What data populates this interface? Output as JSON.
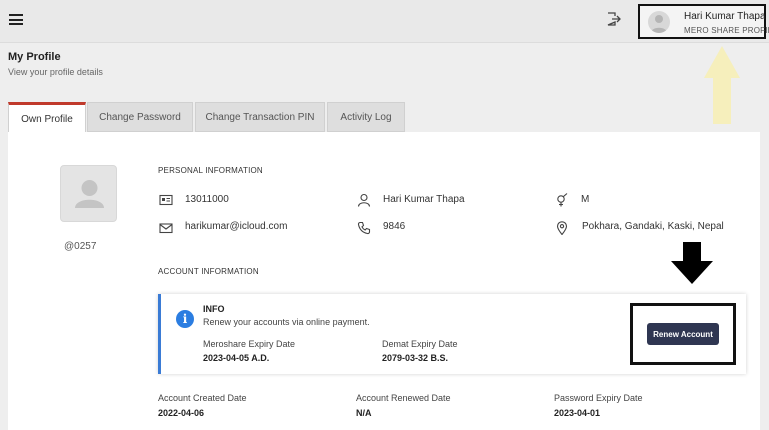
{
  "header": {
    "user_name": "Hari Kumar Thapa",
    "user_subtitle": "MERO SHARE PROFILE"
  },
  "page": {
    "title": "My Profile",
    "subtitle": "View your profile details"
  },
  "tabs": [
    {
      "label": "Own Profile",
      "active": true
    },
    {
      "label": "Change Password",
      "active": false
    },
    {
      "label": "Change Transaction PIN",
      "active": false
    },
    {
      "label": "Activity Log",
      "active": false
    }
  ],
  "profile": {
    "id_label": "@0257",
    "personal_heading": "PERSONAL INFORMATION",
    "client_code": "13011000",
    "name": "Hari Kumar Thapa",
    "gender": "M",
    "email": "harikumar@icloud.com",
    "phone": "9846",
    "address": "Pokhara, Gandaki, Kaski, Nepal"
  },
  "account": {
    "heading": "ACCOUNT INFORMATION",
    "info_title": "INFO",
    "info_message": "Renew your accounts via online payment.",
    "meroshare_expiry_label": "Meroshare Expiry Date",
    "meroshare_expiry_value": "2023-04-05 A.D.",
    "demat_expiry_label": "Demat Expiry Date",
    "demat_expiry_value": "2079-03-32 B.S.",
    "renew_button": "Renew Account",
    "created_label": "Account Created Date",
    "created_value": "2022-04-06",
    "renewed_label": "Account Renewed Date",
    "renewed_value": "N/A",
    "password_expiry_label": "Password Expiry Date",
    "password_expiry_value": "2023-04-01"
  },
  "colors": {
    "accent_red": "#c0392b",
    "info_blue": "#2b7de1",
    "button_navy": "#2f3652",
    "arrow_yellow": "#f6efbc"
  }
}
